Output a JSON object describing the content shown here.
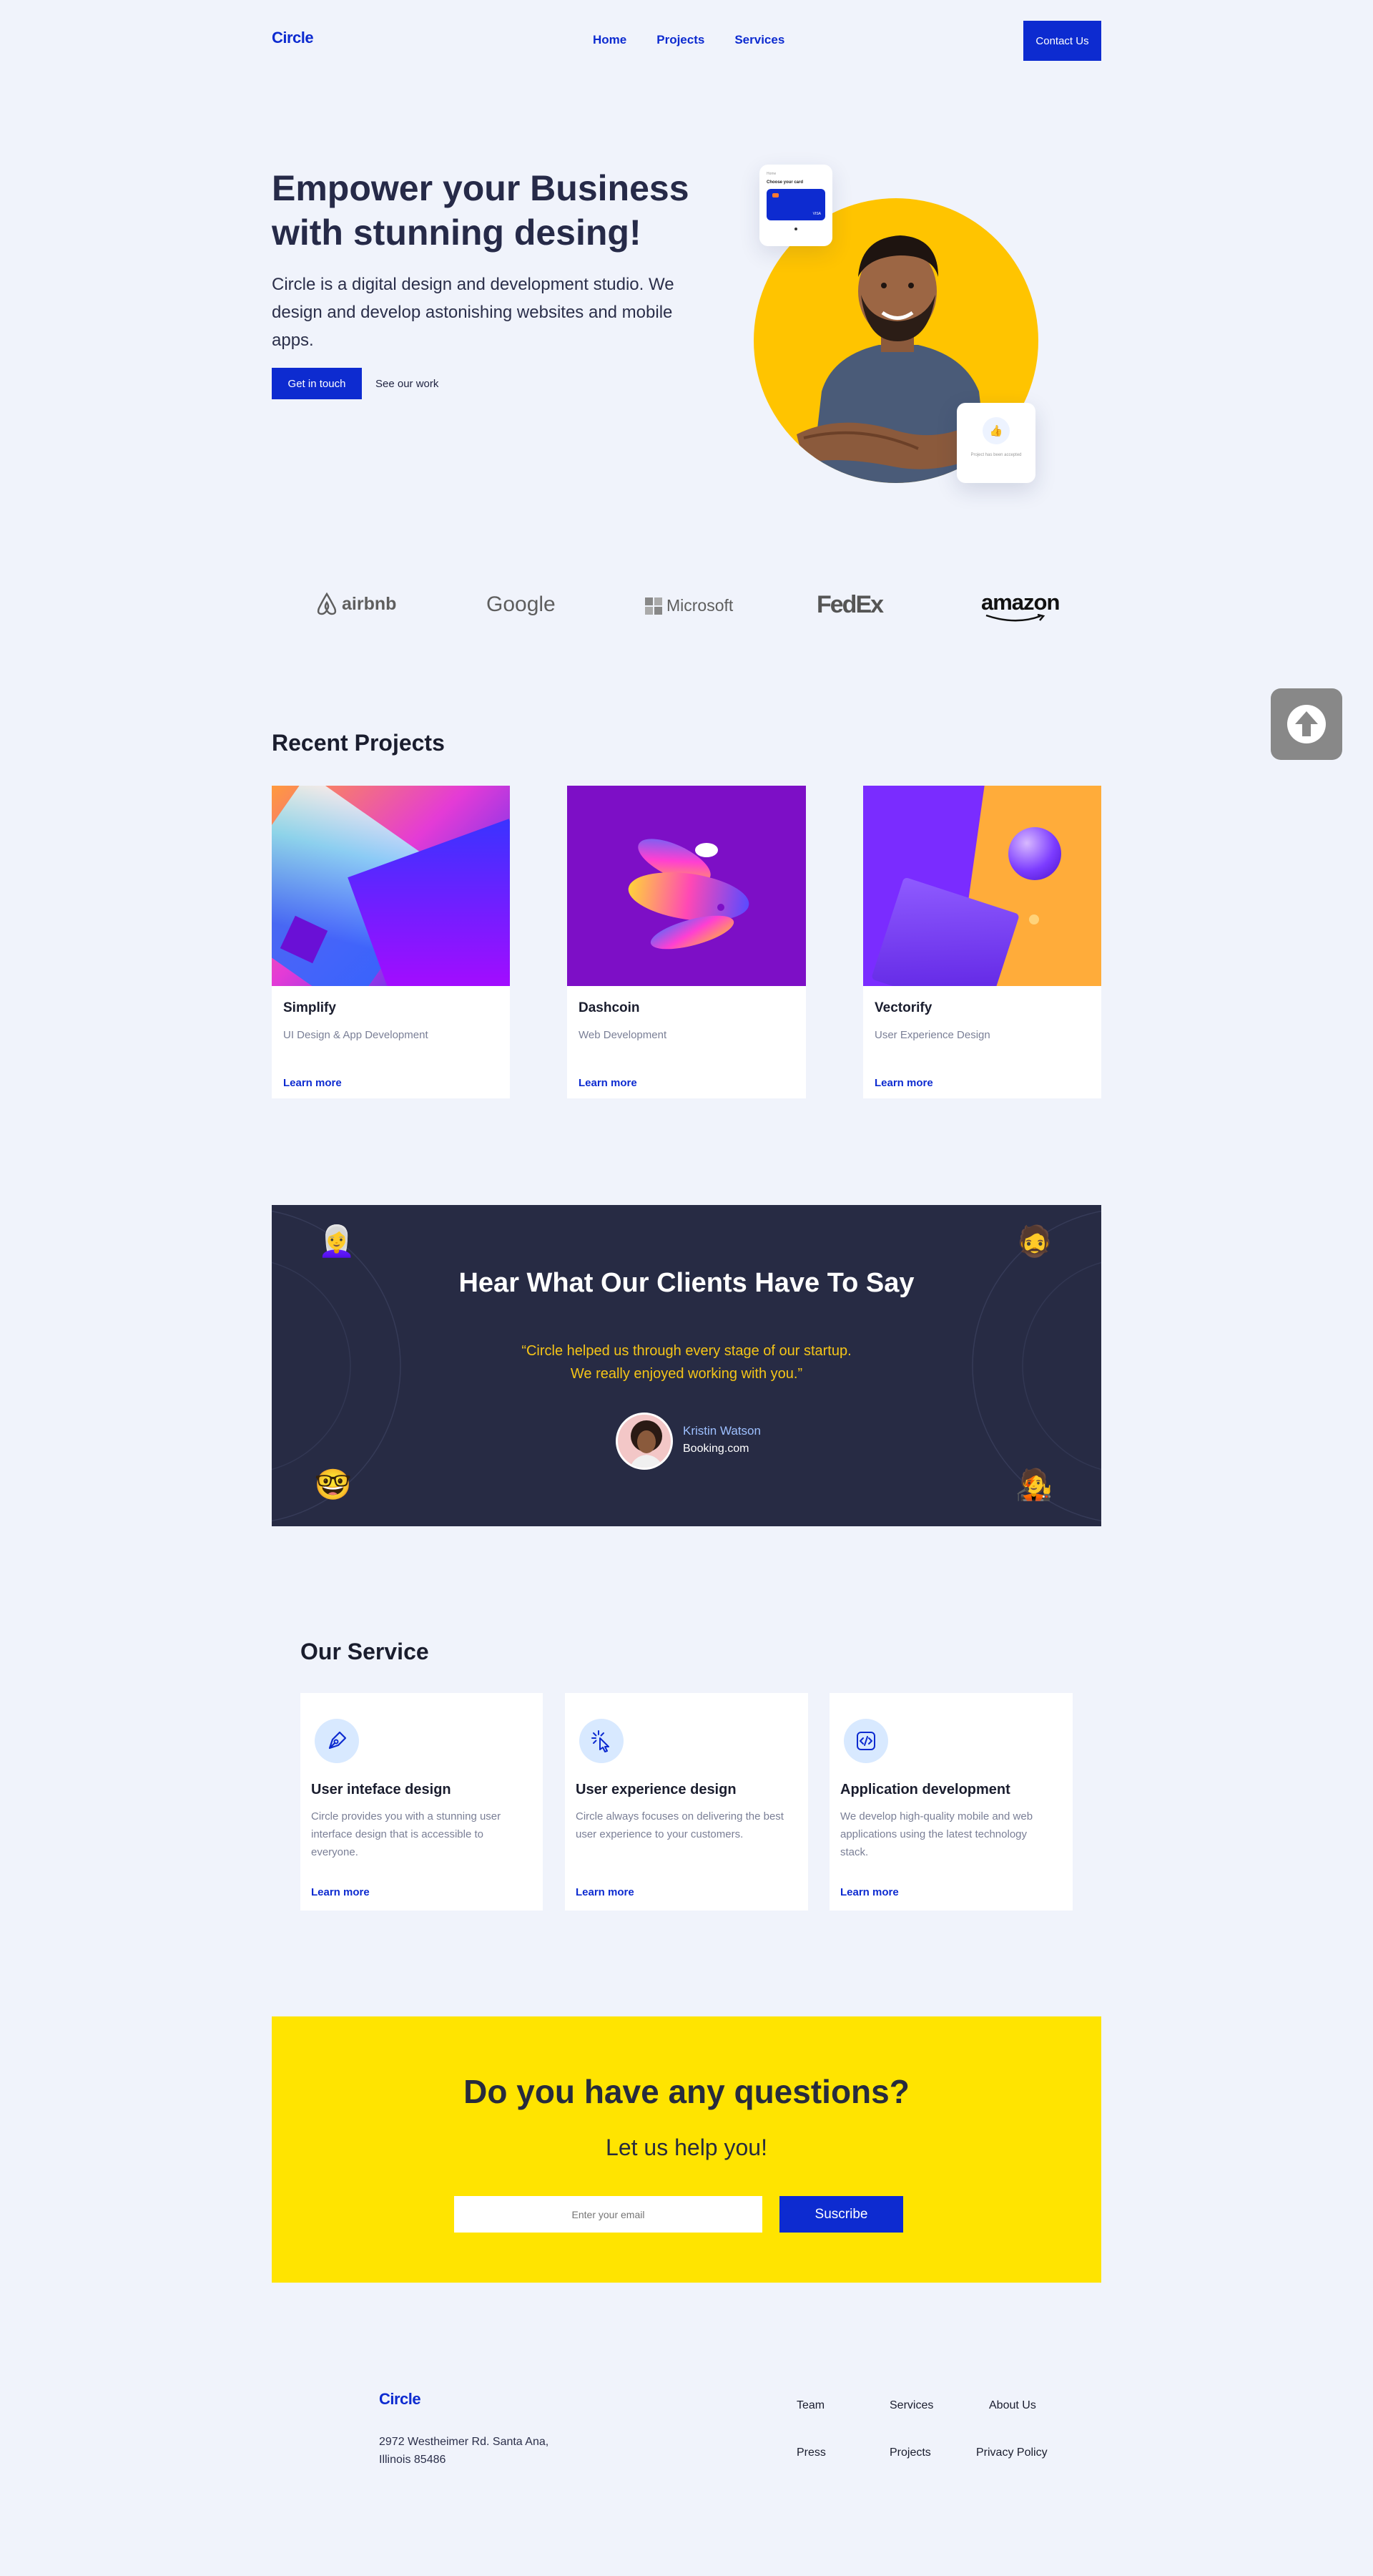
{
  "brand": {
    "logo": "Circle"
  },
  "nav": {
    "home": "Home",
    "projects": "Projects",
    "services": "Services",
    "contact": "Contact Us"
  },
  "hero": {
    "title_line1": "Empower your Business",
    "title_line2": "with stunning desing!",
    "text": "Circle is a digital design and development studio. We design and develop astonishing websites and mobile apps.",
    "primary_cta": "Get in touch",
    "secondary_cta": "See our work",
    "card_top": {
      "small": "Home",
      "title": "Choose your card",
      "card_label": "VISA"
    },
    "card_bottom": {
      "text": "Project has been accepted"
    }
  },
  "logos": [
    "airbnb",
    "Google",
    "Microsoft",
    "FedEx",
    "amazon"
  ],
  "projects": {
    "title": "Recent Projects",
    "items": [
      {
        "name": "Simplify",
        "category": "UI Design & App Development",
        "link": "Learn more"
      },
      {
        "name": "Dashcoin",
        "category": "Web Development",
        "link": "Learn more"
      },
      {
        "name": "Vectorify",
        "category": "User Experience Design",
        "link": "Learn more"
      }
    ]
  },
  "testimonials": {
    "title": "Hear What Our Clients Have To Say",
    "quote_line1": "“Circle helped us through every stage of our startup.",
    "quote_line2": "We really enjoyed working with you.”",
    "author": "Kristin Watson",
    "company": "Booking.com",
    "accent": "#f5c518"
  },
  "services": {
    "title": "Our Service",
    "items": [
      {
        "icon": "pen-tool-icon",
        "title": "User inteface design",
        "text": "Circle provides you with a stunning user interface design that is accessible to everyone.",
        "link": "Learn more"
      },
      {
        "icon": "cursor-click-icon",
        "title": "User experience design",
        "text": "Circle always focuses on delivering the best user experience to your customers.",
        "link": "Learn more"
      },
      {
        "icon": "code-icon",
        "title": "Application development",
        "text": "We develop high-quality mobile and web applications using the latest technology stack.",
        "link": "Learn more"
      }
    ]
  },
  "cta": {
    "title": "Do you have any questions?",
    "subtitle": "Let us help you!",
    "placeholder": "Enter your email",
    "button": "Suscribe",
    "background": "#ffe400"
  },
  "footer": {
    "logo": "Circle",
    "address_line1": "2972 Westheimer Rd. Santa Ana,",
    "address_line2": "Illinois 85486",
    "links": [
      "Team",
      "Services",
      "About Us",
      "Press",
      "Projects",
      "Privacy Policy"
    ]
  },
  "colors": {
    "primary": "#0d2bd0",
    "background": "#f0f3fb",
    "dark": "#272b44",
    "hero_circle": "#ffc400"
  }
}
